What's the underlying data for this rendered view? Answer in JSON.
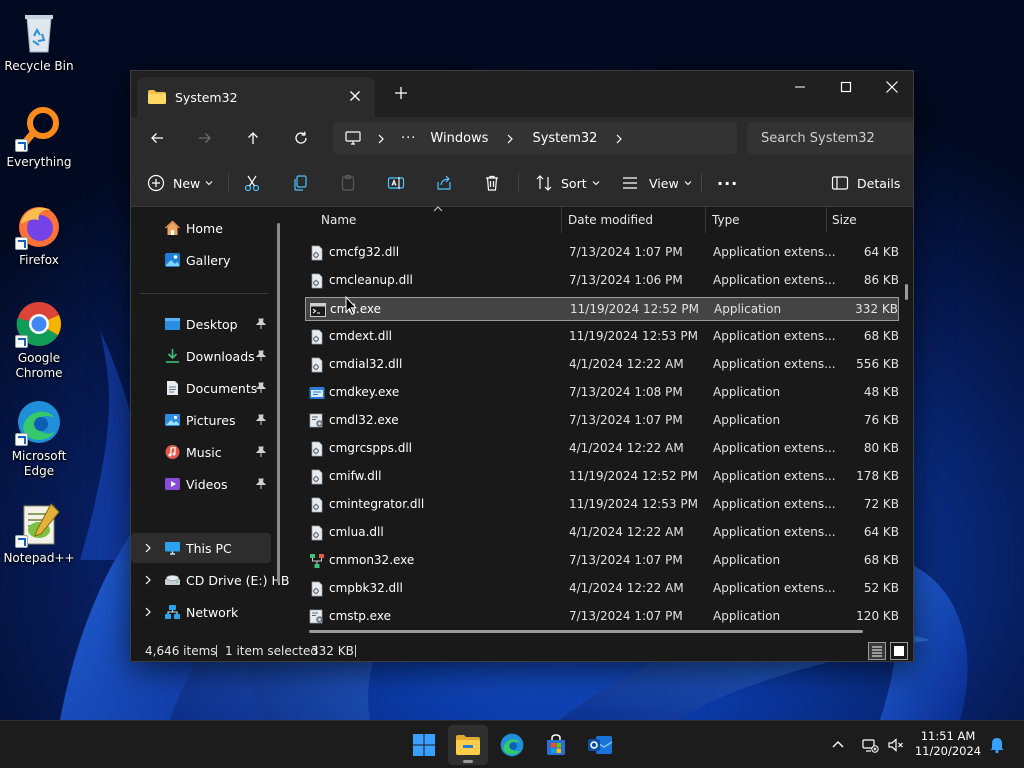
{
  "desktop": {
    "icons": [
      {
        "label": "Recycle Bin"
      },
      {
        "label": "Everything"
      },
      {
        "label": "Firefox"
      },
      {
        "label": "Google Chrome"
      },
      {
        "label": "Microsoft Edge"
      },
      {
        "label": "Notepad++"
      }
    ]
  },
  "window": {
    "tab_title": "System32",
    "new_tab_glyph": "+",
    "address": {
      "segments": [
        "Windows",
        "System32"
      ],
      "more_glyph": "···"
    },
    "search_placeholder": "Search System32",
    "toolbar": {
      "new_label": "New",
      "sort_label": "Sort",
      "view_label": "View",
      "more_glyph": "···",
      "details_label": "Details"
    },
    "navpane": {
      "items": [
        {
          "label": "Home",
          "icon": "home-icon"
        },
        {
          "label": "Gallery",
          "icon": "gallery-icon"
        },
        {
          "label": "Desktop",
          "icon": "desktop-folder-icon",
          "pinned": true
        },
        {
          "label": "Downloads",
          "icon": "downloads-icon",
          "pinned": true
        },
        {
          "label": "Documents",
          "icon": "documents-icon",
          "pinned": true
        },
        {
          "label": "Pictures",
          "icon": "pictures-icon",
          "pinned": true
        },
        {
          "label": "Music",
          "icon": "music-icon",
          "pinned": true
        },
        {
          "label": "Videos",
          "icon": "videos-icon",
          "pinned": true
        },
        {
          "label": "This PC",
          "icon": "this-pc-icon"
        },
        {
          "label": "CD Drive (E:) HB",
          "icon": "cd-drive-icon"
        },
        {
          "label": "Network",
          "icon": "network-icon"
        }
      ]
    },
    "columns": {
      "name": "Name",
      "date": "Date modified",
      "type": "Type",
      "size": "Size"
    },
    "files": [
      {
        "name": "cmcfg32.dll",
        "date": "7/13/2024 1:07 PM",
        "type": "Application extens...",
        "size": "64 KB",
        "icon": "dll-icon"
      },
      {
        "name": "cmcleanup.dll",
        "date": "7/13/2024 1:06 PM",
        "type": "Application extens...",
        "size": "86 KB",
        "icon": "dll-icon"
      },
      {
        "name": "cmd.exe",
        "date": "11/19/2024 12:52 PM",
        "type": "Application",
        "size": "332 KB",
        "icon": "cmd-icon",
        "selected": true
      },
      {
        "name": "cmdext.dll",
        "date": "11/19/2024 12:53 PM",
        "type": "Application extens...",
        "size": "68 KB",
        "icon": "dll-icon"
      },
      {
        "name": "cmdial32.dll",
        "date": "4/1/2024 12:22 AM",
        "type": "Application extens...",
        "size": "556 KB",
        "icon": "dll-icon"
      },
      {
        "name": "cmdkey.exe",
        "date": "7/13/2024 1:08 PM",
        "type": "Application",
        "size": "48 KB",
        "icon": "exe-icon"
      },
      {
        "name": "cmdl32.exe",
        "date": "7/13/2024 1:07 PM",
        "type": "Application",
        "size": "76 KB",
        "icon": "exe-gear-icon"
      },
      {
        "name": "cmgrcspps.dll",
        "date": "4/1/2024 12:22 AM",
        "type": "Application extens...",
        "size": "80 KB",
        "icon": "dll-icon"
      },
      {
        "name": "cmifw.dll",
        "date": "11/19/2024 12:52 PM",
        "type": "Application extens...",
        "size": "178 KB",
        "icon": "dll-icon"
      },
      {
        "name": "cmintegrator.dll",
        "date": "11/19/2024 12:53 PM",
        "type": "Application extens...",
        "size": "72 KB",
        "icon": "dll-icon"
      },
      {
        "name": "cmlua.dll",
        "date": "4/1/2024 12:22 AM",
        "type": "Application extens...",
        "size": "64 KB",
        "icon": "dll-icon"
      },
      {
        "name": "cmmon32.exe",
        "date": "7/13/2024 1:07 PM",
        "type": "Application",
        "size": "68 KB",
        "icon": "exe-network-icon"
      },
      {
        "name": "cmpbk32.dll",
        "date": "4/1/2024 12:22 AM",
        "type": "Application extens...",
        "size": "52 KB",
        "icon": "dll-icon"
      },
      {
        "name": "cmstp.exe",
        "date": "7/13/2024 1:07 PM",
        "type": "Application",
        "size": "120 KB",
        "icon": "exe-gear-icon"
      }
    ],
    "status": {
      "item_count": "4,646 items",
      "selection": "1 item selected",
      "selection_size": "332 KB"
    }
  },
  "taskbar": {
    "apps": [
      "start",
      "file-explorer",
      "edge",
      "store",
      "outlook"
    ],
    "time": "11:51 AM",
    "date": "11/20/2024"
  },
  "colors": {
    "window_bg": "#191919",
    "toolbar_bg": "#2b2b2b",
    "titlebar_bg": "#202020",
    "selection_bg": "#444444",
    "accent": "#4cc2ff",
    "folder_yellow": "#f4c04a"
  }
}
